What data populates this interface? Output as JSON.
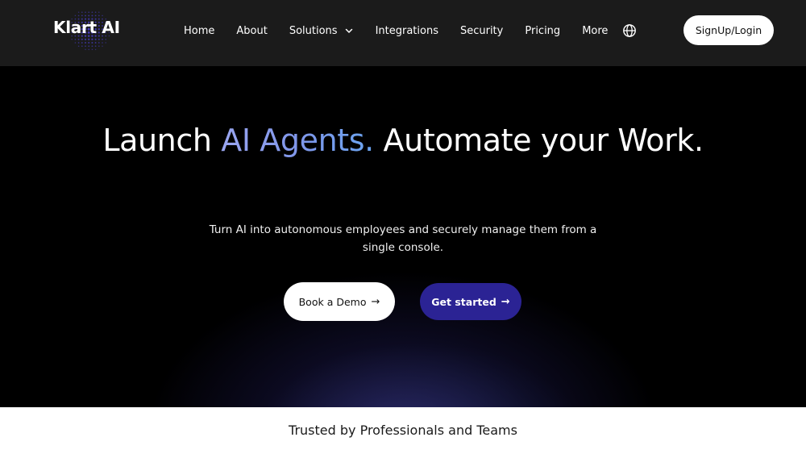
{
  "brand": {
    "name": "Klart AI",
    "accent_color": "#4b3fd0"
  },
  "nav": {
    "items": [
      {
        "label": "Home"
      },
      {
        "label": "About"
      },
      {
        "label": "Solutions",
        "has_dropdown": true
      },
      {
        "label": "Integrations"
      },
      {
        "label": "Security"
      },
      {
        "label": "Pricing"
      },
      {
        "label": "More"
      }
    ],
    "language_icon": "globe-icon",
    "signup_label": "SignUp/Login"
  },
  "hero": {
    "headline_start": "Launch ",
    "headline_highlight": "AI Agents.",
    "headline_end": " Automate your Work.",
    "subtext": "Turn AI into autonomous employees and securely manage them from a single console.",
    "demo_button": "Book a Demo",
    "start_button": "Get started",
    "button_icon": "arrow-right-icon",
    "start_button_color": "#2b2394"
  },
  "trusted": {
    "title": "Trusted by Professionals and Teams"
  }
}
